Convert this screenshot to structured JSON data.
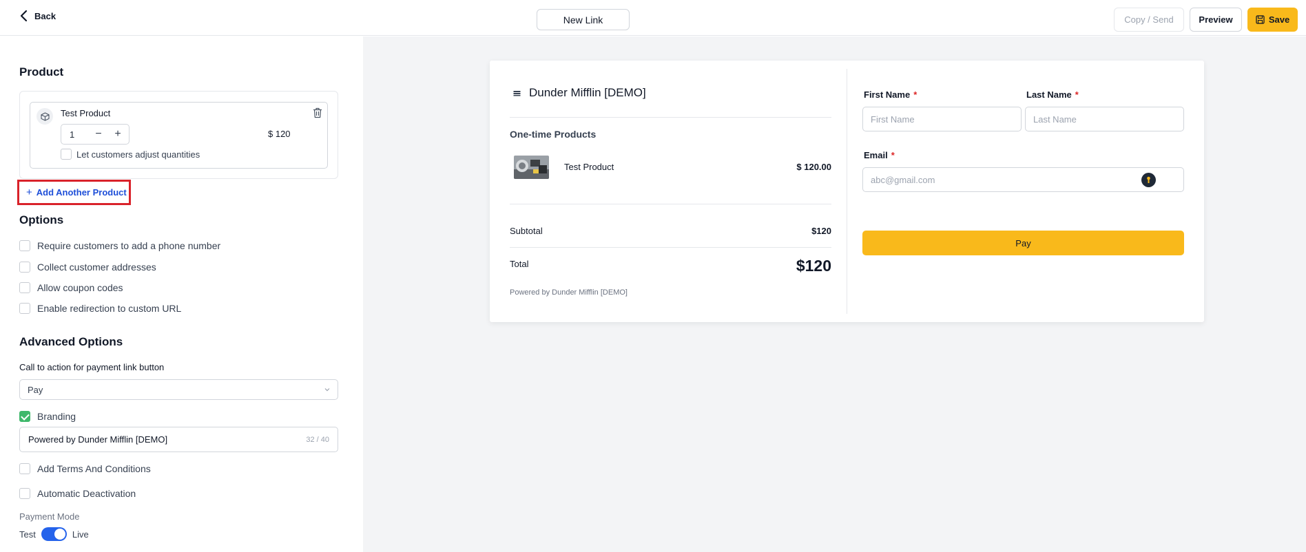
{
  "topbar": {
    "back_label": "Back",
    "link_name": "New Link",
    "copy_label": "Copy / Send",
    "preview_label": "Preview",
    "save_label": "Save"
  },
  "left": {
    "product_heading": "Product",
    "product": {
      "name": "Test Product",
      "quantity": "1",
      "price": "$ 120",
      "adjust_label": "Let customers adjust quantities"
    },
    "add_product_label": "Add Another Product",
    "options_heading": "Options",
    "options": [
      {
        "label": "Require customers to add a phone number",
        "checked": false
      },
      {
        "label": "Collect customer addresses",
        "checked": false
      },
      {
        "label": "Allow coupon codes",
        "checked": false
      },
      {
        "label": "Enable redirection to custom URL",
        "checked": false
      }
    ],
    "advanced_heading": "Advanced Options",
    "cta_label": "Call to action for payment link button",
    "cta_value": "Pay",
    "branding_label": "Branding",
    "branding_checked": true,
    "branding_value": "Powered by Dunder Mifflin [DEMO]",
    "branding_count": "32 / 40",
    "terms_label": "Add Terms And Conditions",
    "deactivation_label": "Automatic Deactivation",
    "payment_mode_label": "Payment Mode",
    "mode_test": "Test",
    "mode_live": "Live",
    "mode_is_live": true
  },
  "preview": {
    "store_name": "Dunder Mifflin [DEMO]",
    "section_title": "One-time Products",
    "item_name": "Test Product",
    "item_price": "$ 120.00",
    "subtotal_label": "Subtotal",
    "subtotal_value": "$120",
    "total_label": "Total",
    "total_value": "$120",
    "powered_by": "Powered by Dunder Mifflin [DEMO]",
    "first_name_label": "First Name",
    "first_name_placeholder": "First Name",
    "last_name_label": "Last Name",
    "last_name_placeholder": "Last Name",
    "email_label": "Email",
    "email_placeholder": "abc@gmail.com",
    "required_mark": "*",
    "pay_label": "Pay"
  },
  "colors": {
    "accent_yellow": "#f9b91b",
    "highlight_red": "#d9222a",
    "link_blue": "#1d4ed8",
    "toggle_blue": "#2563eb",
    "check_green": "#3fb86b"
  }
}
